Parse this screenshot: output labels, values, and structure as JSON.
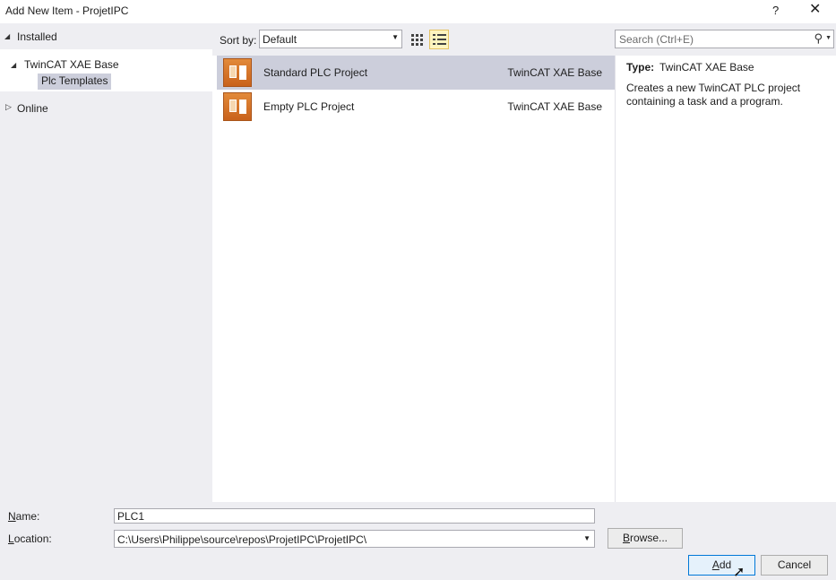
{
  "window": {
    "title": "Add New Item - ProjetIPC",
    "help": "?",
    "close": "✕"
  },
  "tree": {
    "root_label": "Installed",
    "node_label": "TwinCAT XAE Base",
    "child_label": "Plc Templates",
    "online_label": "Online"
  },
  "toolbar": {
    "sort_label": "Sort by:",
    "sort_value": "Default"
  },
  "templates": [
    {
      "name": "Standard PLC Project",
      "type": "TwinCAT XAE Base"
    },
    {
      "name": "Empty PLC Project",
      "type": "TwinCAT XAE Base"
    }
  ],
  "search": {
    "placeholder": "Search (Ctrl+E)"
  },
  "details": {
    "type_label": "Type:",
    "type_value": "TwinCAT XAE Base",
    "description": "Creates a new TwinCAT PLC project containing a task and a program."
  },
  "form": {
    "name_label_first": "N",
    "name_label_rest": "ame:",
    "name_value": "PLC1",
    "location_label_first": "L",
    "location_label_rest": "ocation:",
    "location_value": "C:\\Users\\Philippe\\source\\repos\\ProjetIPC\\ProjetIPC\\"
  },
  "buttons": {
    "browse_first": "B",
    "browse_rest": "rowse...",
    "add_first": "A",
    "add_rest": "dd",
    "cancel": "Cancel"
  }
}
